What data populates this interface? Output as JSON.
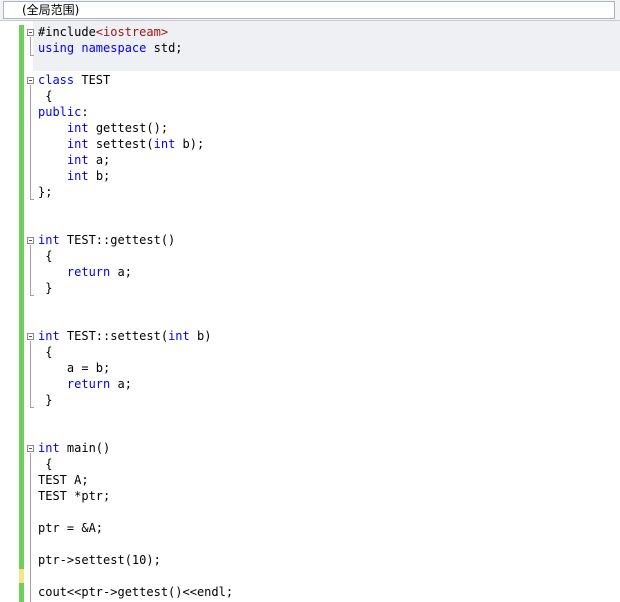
{
  "scope": {
    "label": "(全局范围)"
  },
  "colors": {
    "change_saved": "#6ccf5e",
    "change_unsaved": "#f3e58c",
    "keyword": "#0000ff",
    "include_target": "#a31515"
  },
  "code": {
    "l1": {
      "kw": "",
      "rest": "#include",
      "inc": "<iostream>"
    },
    "l2": {
      "kw1": "using",
      "kw2": "namespace",
      "rest": " std;"
    },
    "l3": {
      "kw": "class",
      "rest": " TEST"
    },
    "l4": "{",
    "l5": {
      "kw": "public",
      "rest": ":"
    },
    "l6": {
      "kw": "int",
      "rest": " gettest();"
    },
    "l7": {
      "kw": "int",
      "rest": " settest(",
      "kw2": "int",
      "rest2": " b);"
    },
    "l8": {
      "kw": "int",
      "rest": " a;"
    },
    "l9": {
      "kw": "int",
      "rest": " b;"
    },
    "l10": "};",
    "l11": {
      "kw": "int",
      "rest": " TEST::gettest()"
    },
    "l12": "{",
    "l13": {
      "kw": "return",
      "rest": " a;"
    },
    "l14": "}",
    "l15": {
      "kw": "int",
      "rest": " TEST::settest(",
      "kw2": "int",
      "rest2": " b)"
    },
    "l16": "{",
    "l17": "a = b;",
    "l18": {
      "kw": "return",
      "rest": " a;"
    },
    "l19": "}",
    "l20": {
      "kw": "int",
      "rest": " main()"
    },
    "l21": "{",
    "l22": "TEST A;",
    "l23": "TEST *ptr;",
    "l24": "ptr = &A;",
    "l25": "ptr->settest(10);",
    "l26": "cout<<ptr->gettest()<<endl;"
  }
}
